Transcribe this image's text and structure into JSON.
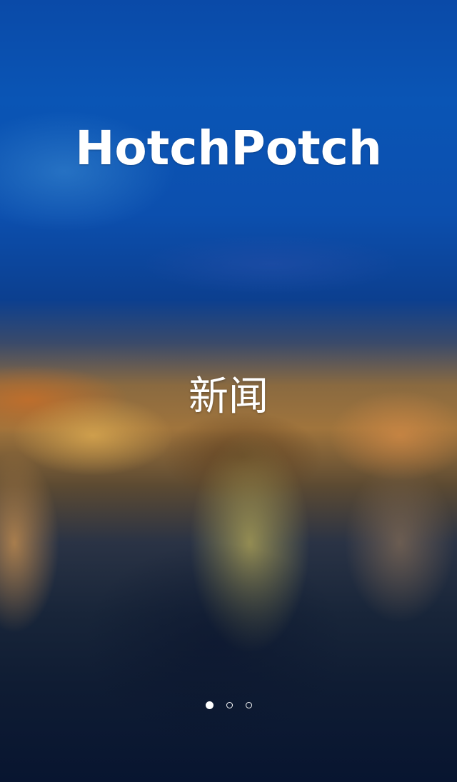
{
  "app": {
    "title": "HotchPotch"
  },
  "slide": {
    "label": "新闻"
  },
  "pager": {
    "total": 3,
    "active_index": 0
  },
  "colors": {
    "text": "#ffffff",
    "sky_blue": "#0a4aa8",
    "city_light_orange": "#a0743c",
    "night_navy": "#081530"
  }
}
